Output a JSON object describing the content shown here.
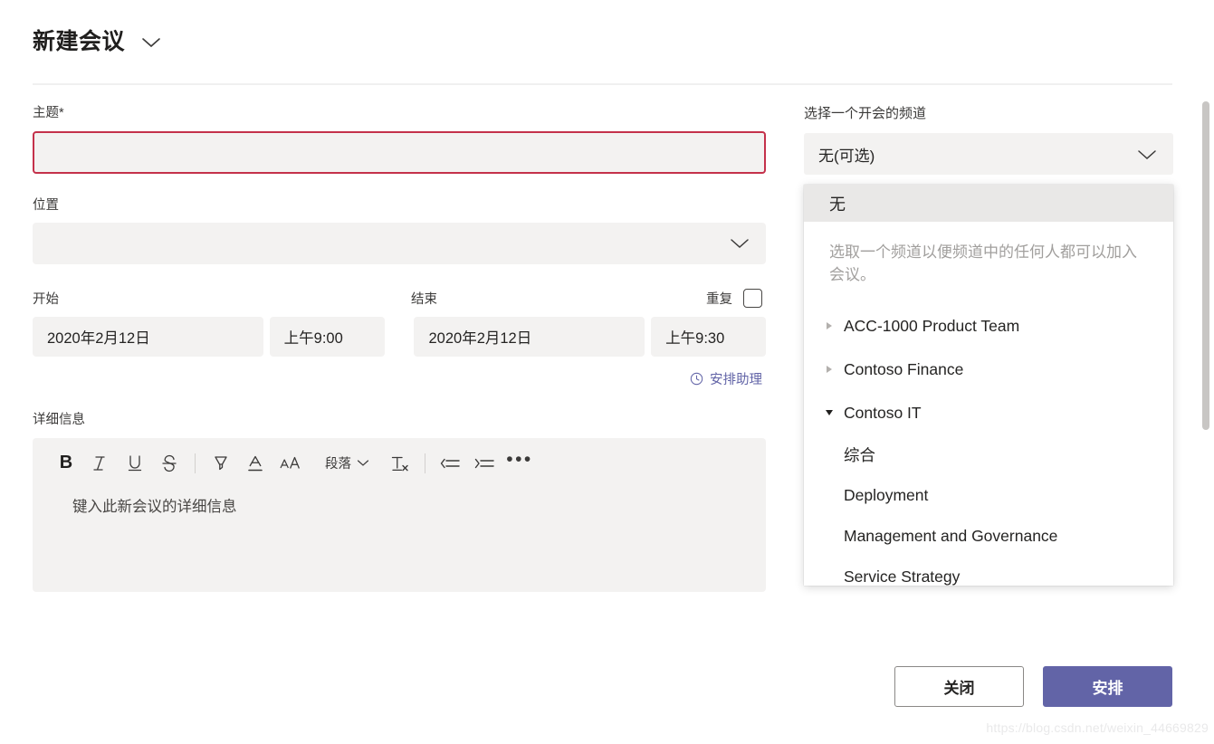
{
  "header": {
    "title": "新建会议",
    "chevron_icon": "chevron-down-icon"
  },
  "form": {
    "subject": {
      "label": "主题*",
      "value": "",
      "placeholder": "",
      "error_color": "#c4314b"
    },
    "location": {
      "label": "位置",
      "value": "",
      "chevron_icon": "chevron-down-icon"
    },
    "start": {
      "label": "开始",
      "date": "2020年2月12日",
      "time": "上午9:00"
    },
    "end": {
      "label": "结束",
      "date": "2020年2月12日",
      "time": "上午9:30"
    },
    "recurrence": {
      "label": "重复",
      "checked": false
    },
    "scheduling_assistant": {
      "label": "安排助理",
      "icon": "clock-icon",
      "color": "#6264a7"
    },
    "details": {
      "label": "详细信息",
      "placeholder": "键入此新会议的详细信息",
      "toolbar": [
        {
          "name": "bold-icon",
          "label": "B"
        },
        {
          "name": "italic-icon",
          "label": "I"
        },
        {
          "name": "underline-icon",
          "label": "U"
        },
        {
          "name": "strikethrough-icon",
          "label": "S"
        },
        {
          "name": "highlight-icon",
          "label": ""
        },
        {
          "name": "font-color-icon",
          "label": "A"
        },
        {
          "name": "font-size-icon",
          "label": "AA"
        },
        {
          "name": "paragraph-style-dropdown",
          "label": "段落"
        },
        {
          "name": "clear-formatting-icon",
          "label": "Tx"
        },
        {
          "name": "decrease-indent-icon",
          "label": ""
        },
        {
          "name": "increase-indent-icon",
          "label": ""
        },
        {
          "name": "more-options-icon",
          "label": "•••"
        }
      ],
      "paragraph_label": "段落",
      "more_label": "•••"
    }
  },
  "channel": {
    "label": "选择一个开会的频道",
    "selected": "无(可选)",
    "chevron_icon": "chevron-down-icon",
    "annotation_color": "#ee1c1c",
    "dropdown": {
      "none_option": "无",
      "hint": "选取一个频道以便频道中的任何人都可以加入会议。",
      "teams": [
        {
          "name": "ACC-1000 Product Team",
          "expanded": false,
          "channels": []
        },
        {
          "name": "Contoso Finance",
          "expanded": false,
          "channels": []
        },
        {
          "name": "Contoso IT",
          "expanded": true,
          "channels": [
            "综合",
            "Deployment",
            "Management and Governance",
            "Service Strategy"
          ]
        }
      ]
    }
  },
  "footer": {
    "close_label": "关闭",
    "schedule_label": "安排",
    "schedule_color": "#6264a7"
  },
  "watermark": "https://blog.csdn.net/weixin_44669829"
}
